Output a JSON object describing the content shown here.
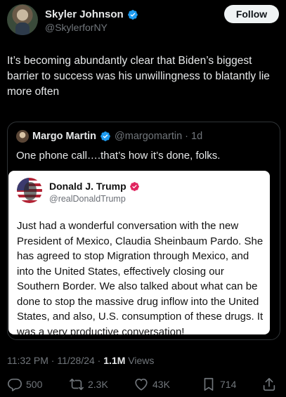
{
  "post": {
    "author_name": "Skyler Johnson",
    "author_handle": "@SkylerforNY",
    "follow_label": "Follow",
    "text": "It’s becoming abundantly clear that Biden’s biggest barrier to success was his unwillingness to blatantly lie more often",
    "timestamp": "11:32 PM · 11/28/24 · ",
    "views_count": "1.1M",
    "views_label": " Views"
  },
  "quote": {
    "author_name": "Margo Martin",
    "author_handle": "@margomartin · 1d",
    "text": "One phone call….that’s how it’s done, folks."
  },
  "truth_card": {
    "author_name": "Donald J. Trump",
    "author_handle": "@realDonaldTrump",
    "text": "Just had a wonderful conversation with the new President of Mexico, Claudia Sheinbaum Pardo. She has agreed to stop Migration through Mexico, and into the United States, effectively closing our Southern Border. We also talked about what can be done to stop the massive drug inflow into the United States, and also, U.S. consumption of these drugs. It was a very productive conversation!"
  },
  "actions": {
    "replies": "500",
    "reposts": "2.3K",
    "likes": "43K",
    "bookmarks": "714"
  },
  "icons": {
    "verified": "verified-badge-icon",
    "reply": "reply-icon",
    "repost": "repost-icon",
    "like": "heart-icon",
    "bookmark": "bookmark-icon",
    "share": "share-icon"
  },
  "colors": {
    "verified_blue": "#1d9bf0",
    "truth_verified": "#e0245e",
    "muted": "#71767b"
  }
}
